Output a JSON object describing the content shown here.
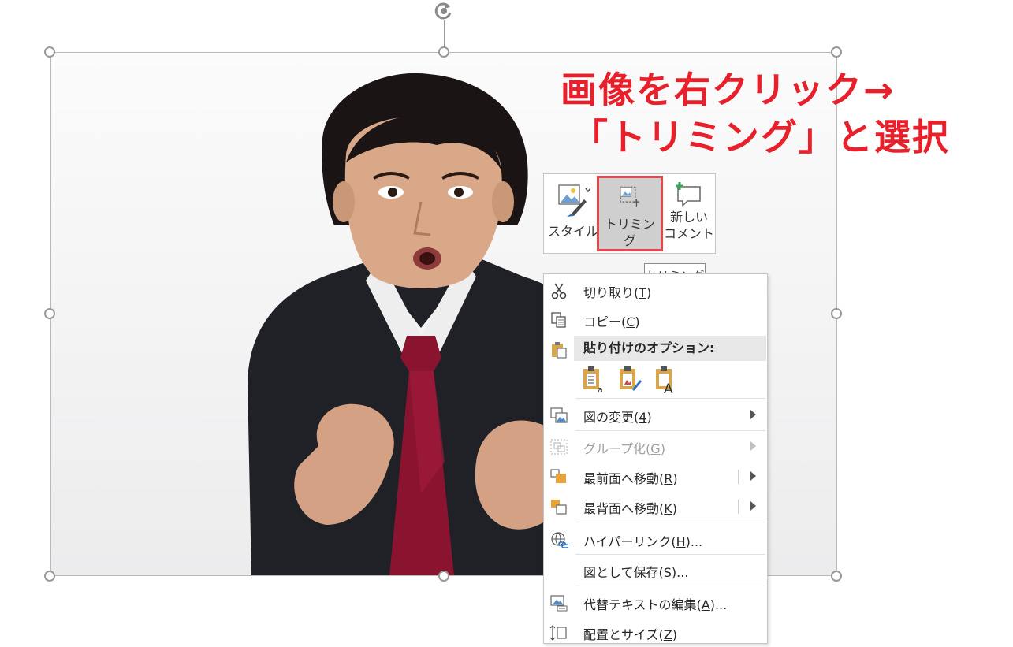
{
  "annotation": {
    "line1": "画像を右クリック→",
    "line2": "「トリミング」と選択",
    "color": "#e8202b"
  },
  "mini_toolbar": {
    "style_label": "スタイル",
    "trim_label": "トリミング",
    "new_comment_line1": "新しい",
    "new_comment_line2": "コメント",
    "highlight_color": "#e8454c"
  },
  "tooltip": {
    "text": "トリミング"
  },
  "context_menu": {
    "cut": {
      "label": "切り取り(",
      "key": "T",
      "tail": ")"
    },
    "copy": {
      "label": "コピー(",
      "key": "C",
      "tail": ")"
    },
    "paste_options": "貼り付けのオプション:",
    "change_picture": {
      "label": "図の変更(",
      "key": "4",
      "tail": ")"
    },
    "group": {
      "label": "グループ化(",
      "key": "G",
      "tail": ")"
    },
    "bring_to_front": {
      "label": "最前面へ移動(",
      "key": "R",
      "tail": ")"
    },
    "send_to_back": {
      "label": "最背面へ移動(",
      "key": "K",
      "tail": ")"
    },
    "hyperlink": {
      "label": "ハイパーリンク(",
      "key": "H",
      "tail": ")..."
    },
    "save_as_picture": {
      "label": "図として保存(",
      "key": "S",
      "tail": ")..."
    },
    "edit_alt_text": {
      "label": "代替テキストの編集(",
      "key": "A",
      "tail": ")..."
    },
    "size_position": {
      "label": "配置とサイズ(",
      "key": "Z",
      "tail": ")"
    }
  }
}
